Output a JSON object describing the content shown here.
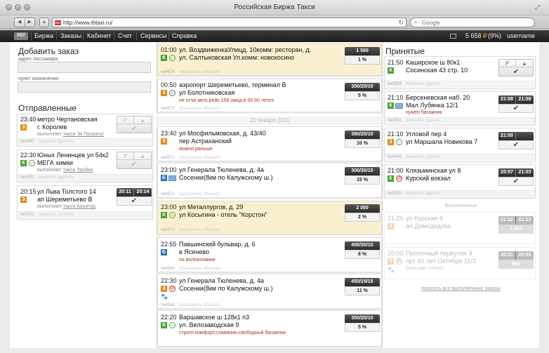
{
  "window": {
    "title": "Российская Биржа Такси"
  },
  "browser": {
    "url": "http://www.rbtaxi.ru/",
    "search_placeholder": "Google"
  },
  "navbar": {
    "logo": "РБТ",
    "items": [
      "Биржа",
      "Заказы",
      "Кабинет",
      "Счет",
      "Сервисы",
      "Справка"
    ],
    "balance": "5 658",
    "currency": "₽",
    "percent": "(9%)",
    "username": "username"
  },
  "add_order": {
    "title": "Добавить заказ",
    "pickup_label": "адрес пассажира",
    "dest_label": "пункт назначения"
  },
  "sent": {
    "title": "Отправленные",
    "cards": [
      {
        "time": "23:40",
        "addr1": "метро Чертановская",
        "addr2": "г. Королев",
        "executor_prefix": "выполняет",
        "executor": "такси Эк Прокачу!",
        "id": "№4487",
        "links": "изменить  удалить"
      },
      {
        "time": "22:30",
        "addr1": "Юных Ленинцев ул 54к2",
        "addr2": "МЕГА химки",
        "executor_prefix": "выполняет",
        "executor": "такси Тройка",
        "id": "№4391",
        "links": "изменить  удалить"
      },
      {
        "time": "20:15",
        "addr1": "ул Льва Толстого 14",
        "addr2": "ап Шереметьево В",
        "executor_prefix": "выполняет",
        "executor": "такси Авиатор",
        "id": "№4201",
        "links": "изменить  удалить",
        "t1": "20:11",
        "t2": "20:14"
      }
    ]
  },
  "exchange": {
    "date_divider": "21 января 2011",
    "cards": [
      {
        "time": "01:00",
        "addr1": "ул. ВоздвиженкаУлицд. 10комм: ресторан, д.",
        "addr2": "ул. Салтыковская Ул.комм: новокосино",
        "price": "1 500",
        "pct": "1 %",
        "id": "№4574",
        "links": "предложить  обещать"
      },
      {
        "time": "00:50",
        "addr1": "аэропорт Шереметьево, терминал В",
        "addr2": "ул Болотниковская",
        "note": "не отчи авто рейс 156 ожид в 00.50 летит.",
        "price": "350/20/10",
        "pct": "5 %",
        "id": "№4573",
        "links": "предложить  обещать"
      },
      {
        "time": "23:40",
        "addr1": "ул Мосфильмовская, д. 43/40",
        "addr2": "пер Астраханский",
        "note": "можно раньше",
        "price": "380/20/10",
        "pct": "10 %",
        "id": "№4572",
        "links": "предложить  обещать"
      },
      {
        "time": "23:00",
        "addr1": "ул Генерала Тюленева, д. 4а",
        "addr2": "Сосенки(8км по Калужскому ш.)",
        "price": "300/30/15",
        "pct": "15 %",
        "id": "№4571",
        "links": "предложить  обещать"
      },
      {
        "time": "23:00",
        "addr1": "ул Металлургов, д. 29",
        "addr2": "ул Косыгина - отель \"Корстон\"",
        "price": "2 000",
        "pct": "2 %",
        "id": "№4570",
        "links": "предложить  обещать"
      },
      {
        "time": "22:55",
        "addr1": "Павшинский бульвар, д. 6",
        "addr2": "в Ясенево",
        "note": "по волоколамке",
        "price": "400/30/10",
        "pct": "8 %",
        "id": "№4569",
        "links": "предложить  обещать"
      },
      {
        "time": "22:30",
        "addr1": "ул Генерала Тюленева, д. 4а",
        "addr2": "Сосенки(8км по Калужскому ш.)",
        "price": "450/15/15",
        "pct": "11 %",
        "id": "№4568",
        "links": "предложить  обещать"
      },
      {
        "time": "22:20",
        "addr1": "Варшавское ш 128к1 п3",
        "addr2": "ул. Велозаводская 9",
        "note": "строго комфорт,славянин,свободный багажник",
        "price": "350/20/10",
        "pct": "5 %",
        "id": "",
        "links": ""
      }
    ]
  },
  "accepted": {
    "title": "Принятые",
    "cards": [
      {
        "time": "21:50",
        "addr1": "Каширское ш 80к1",
        "addr2": "Сосинская 43 стр. 10",
        "id": "№4559",
        "links": "изменить  удалить"
      },
      {
        "time": "21:10",
        "addr1": "Берсеневская наб. 20",
        "addr2": "Мал Лубянка 12/1",
        "note": "нужен багажник",
        "t1": "21:08",
        "t2": "21:08",
        "id": "№4551",
        "links": "изменить  удалить"
      },
      {
        "time": "21:10",
        "addr1": "Угловой пер 4",
        "addr2": "ул Маршала Новикова 7",
        "t1": "21:00",
        "t2": "",
        "id": "№4545",
        "links": "изменить  удалить"
      },
      {
        "time": "21:00",
        "addr1": "Клязьминская ул 8",
        "addr2": "Курский вокзал",
        "t1": "20:57",
        "t2": "21:03",
        "id": "№4530",
        "links": "изменить  удалить"
      }
    ],
    "done_label": "Выполненные",
    "done_cards": [
      {
        "time": "21:20",
        "addr1": "ул Курская 4",
        "addr2": "ап Домодедово",
        "t1": "21:12",
        "t2": "21:13",
        "price": "1 850"
      },
      {
        "time": "20:00",
        "addr1": "Проточный переулок 4",
        "addr2": "прт 40 лет Октября 11/3",
        "note": "большая собака",
        "t1": "20:01",
        "t2": "20:03",
        "price": "980"
      }
    ],
    "show_all": "показать все выполненные заказы"
  },
  "colors": {
    "yellow_row": "#faf0cf",
    "badge_z": "#e88a1a",
    "badge_k": "#4ca336",
    "badge_b": "#2a6fb5",
    "note": "#b03020"
  }
}
